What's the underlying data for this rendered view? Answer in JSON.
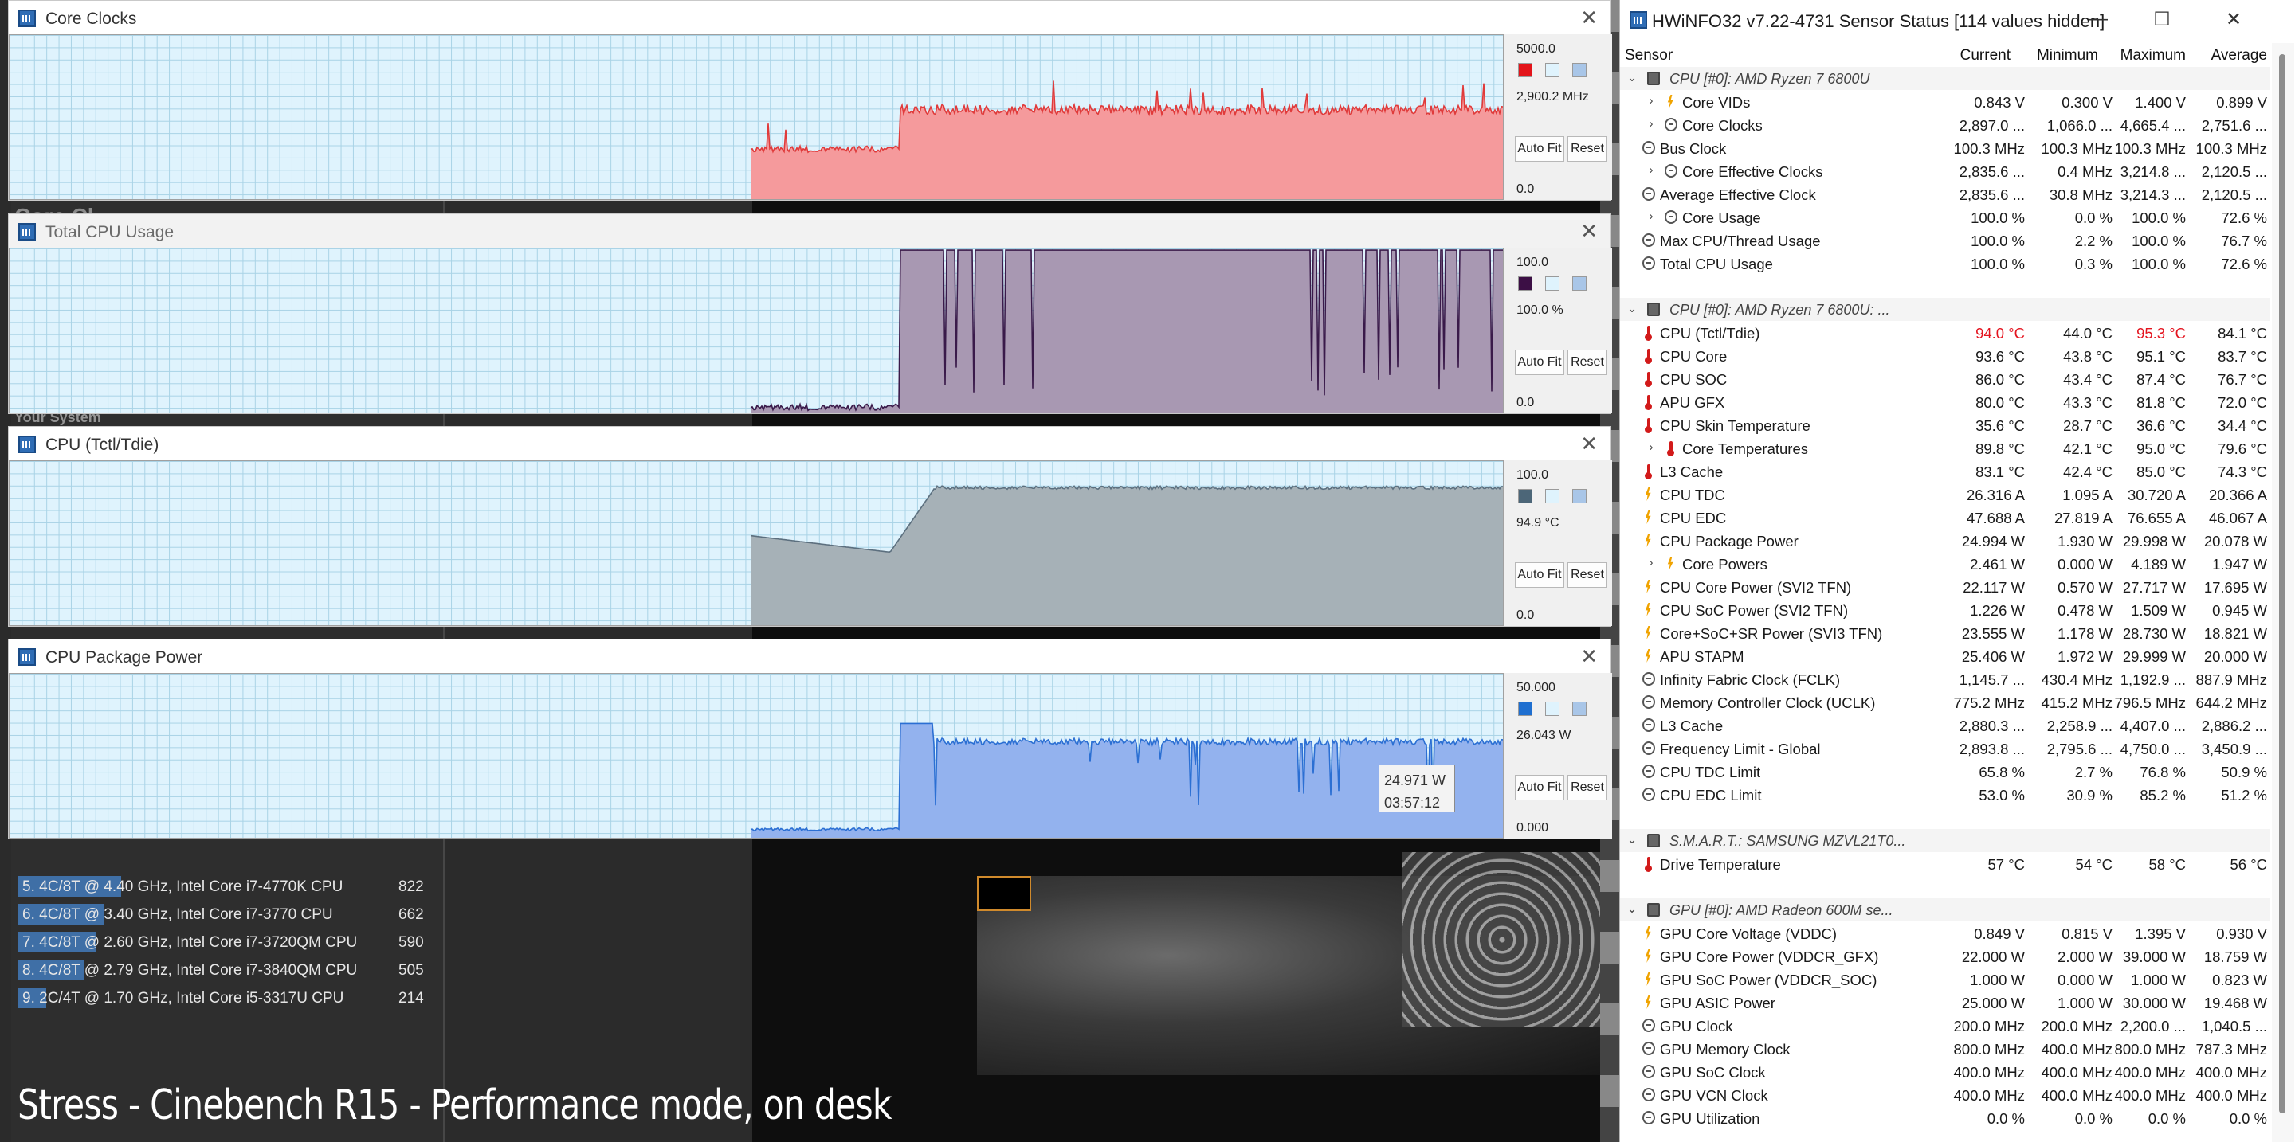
{
  "background": {
    "ghost_heading": "Core Cl...",
    "ghost_your_system": "Your System",
    "caption": "Stress - Cinebench R15 - Performance mode, on desk",
    "rankings": [
      {
        "label": "5. 4C/8T @ 4.40 GHz, Intel Core i7-4770K CPU",
        "score": "822",
        "bar_fraction": 0.25
      },
      {
        "label": "6. 4C/8T @ 3.40 GHz, Intel Core i7-3770 CPU",
        "score": "662",
        "bar_fraction": 0.21
      },
      {
        "label": "7. 4C/8T @ 2.60 GHz, Intel Core i7-3720QM CPU",
        "score": "590",
        "bar_fraction": 0.19
      },
      {
        "label": "8. 4C/8T @ 2.79 GHz, Intel Core i7-3840QM CPU",
        "score": "505",
        "bar_fraction": 0.16
      },
      {
        "label": "9. 2C/4T @ 1.70 GHz, Intel Core i5-3317U CPU",
        "score": "214",
        "bar_fraction": 0.07
      }
    ]
  },
  "graphs": [
    {
      "title": "Core Clocks",
      "max_label": "5000.0",
      "current_label": "2,900.2 MHz",
      "min_label": "0.0",
      "line_color": "#e03a3a",
      "fill_color": "#f59a9c",
      "swatch_color": "#e3141a",
      "active": true,
      "autofit_label": "Auto Fit",
      "reset_label": "Reset"
    },
    {
      "title": "Total CPU Usage",
      "max_label": "100.0",
      "current_label": "100.0 %",
      "min_label": "0.0",
      "line_color": "#3a1a4a",
      "fill_color": "#a898b2",
      "swatch_color": "#3c0f45",
      "active": false,
      "autofit_label": "Auto Fit",
      "reset_label": "Reset"
    },
    {
      "title": "CPU (Tctl/Tdie)",
      "max_label": "100.0",
      "current_label": "94.9 °C",
      "min_label": "0.0",
      "line_color": "#5c6f7e",
      "fill_color": "#a6b1b7",
      "swatch_color": "#4c6678",
      "active": true,
      "autofit_label": "Auto Fit",
      "reset_label": "Reset"
    },
    {
      "title": "CPU Package Power",
      "max_label": "50.000",
      "current_label": "26.043 W",
      "min_label": "0.000",
      "line_color": "#2b6fd3",
      "fill_color": "#93b2ee",
      "swatch_color": "#1f6fd0",
      "active": true,
      "autofit_label": "Auto Fit",
      "reset_label": "Reset"
    }
  ],
  "tooltip": {
    "value": "24.971 W",
    "time": "03:57:12"
  },
  "sensor_window": {
    "title": "HWiNFO32 v7.22-4731 Sensor Status [114 values hidden]",
    "headers": {
      "sensor": "Sensor",
      "current": "Current",
      "minimum": "Minimum",
      "maximum": "Maximum",
      "average": "Average"
    },
    "rows": [
      {
        "type": "group",
        "name": "CPU [#0]: AMD Ryzen 7 6800U"
      },
      {
        "name": "Core VIDs",
        "icon": "bolt",
        "expand": true,
        "cur": "0.843 V",
        "min": "0.300 V",
        "max": "1.400 V",
        "avg": "0.899 V"
      },
      {
        "name": "Core Clocks",
        "icon": "clock",
        "expand": true,
        "cur": "2,897.0 ...",
        "min": "1,066.0 ...",
        "max": "4,665.4 ...",
        "avg": "2,751.6 ..."
      },
      {
        "name": "Bus Clock",
        "icon": "clock",
        "cur": "100.3 MHz",
        "min": "100.3 MHz",
        "max": "100.3 MHz",
        "avg": "100.3 MHz"
      },
      {
        "name": "Core Effective Clocks",
        "icon": "clock",
        "expand": true,
        "cur": "2,835.6 ...",
        "min": "0.4 MHz",
        "max": "3,214.8 ...",
        "avg": "2,120.5 ..."
      },
      {
        "name": "Average Effective Clock",
        "icon": "clock",
        "cur": "2,835.6 ...",
        "min": "30.8 MHz",
        "max": "3,214.3 ...",
        "avg": "2,120.5 ..."
      },
      {
        "name": "Core Usage",
        "icon": "clock",
        "expand": true,
        "cur": "100.0 %",
        "min": "0.0 %",
        "max": "100.0 %",
        "avg": "72.6 %"
      },
      {
        "name": "Max CPU/Thread Usage",
        "icon": "clock",
        "cur": "100.0 %",
        "min": "2.2 %",
        "max": "100.0 %",
        "avg": "76.7 %"
      },
      {
        "name": "Total CPU Usage",
        "icon": "clock",
        "cur": "100.0 %",
        "min": "0.3 %",
        "max": "100.0 %",
        "avg": "72.6 %"
      },
      {
        "type": "blank"
      },
      {
        "type": "group",
        "name": "CPU [#0]: AMD Ryzen 7 6800U: ..."
      },
      {
        "name": "CPU (Tctl/Tdie)",
        "icon": "therm",
        "cur": "94.0 °C",
        "min": "44.0 °C",
        "max": "95.3 °C",
        "avg": "84.1 °C",
        "red_cur": true,
        "red_max": true
      },
      {
        "name": "CPU Core",
        "icon": "therm",
        "cur": "93.6 °C",
        "min": "43.8 °C",
        "max": "95.1 °C",
        "avg": "83.7 °C"
      },
      {
        "name": "CPU SOC",
        "icon": "therm",
        "cur": "86.0 °C",
        "min": "43.4 °C",
        "max": "87.4 °C",
        "avg": "76.7 °C"
      },
      {
        "name": "APU GFX",
        "icon": "therm",
        "cur": "80.0 °C",
        "min": "43.3 °C",
        "max": "81.8 °C",
        "avg": "72.0 °C"
      },
      {
        "name": "CPU Skin Temperature",
        "icon": "therm",
        "cur": "35.6 °C",
        "min": "28.7 °C",
        "max": "36.6 °C",
        "avg": "34.4 °C"
      },
      {
        "name": "Core Temperatures",
        "icon": "therm",
        "expand": true,
        "cur": "89.8 °C",
        "min": "42.1 °C",
        "max": "95.0 °C",
        "avg": "79.6 °C"
      },
      {
        "name": "L3 Cache",
        "icon": "therm",
        "cur": "83.1 °C",
        "min": "42.4 °C",
        "max": "85.0 °C",
        "avg": "74.3 °C"
      },
      {
        "name": "CPU TDC",
        "icon": "bolt",
        "cur": "26.316 A",
        "min": "1.095 A",
        "max": "30.720 A",
        "avg": "20.366 A"
      },
      {
        "name": "CPU EDC",
        "icon": "bolt",
        "cur": "47.688 A",
        "min": "27.819 A",
        "max": "76.655 A",
        "avg": "46.067 A"
      },
      {
        "name": "CPU Package Power",
        "icon": "bolt",
        "cur": "24.994 W",
        "min": "1.930 W",
        "max": "29.998 W",
        "avg": "20.078 W"
      },
      {
        "name": "Core Powers",
        "icon": "bolt",
        "expand": true,
        "cur": "2.461 W",
        "min": "0.000 W",
        "max": "4.189 W",
        "avg": "1.947 W"
      },
      {
        "name": "CPU Core Power (SVI2 TFN)",
        "icon": "bolt",
        "cur": "22.117 W",
        "min": "0.570 W",
        "max": "27.717 W",
        "avg": "17.695 W"
      },
      {
        "name": "CPU SoC Power (SVI2 TFN)",
        "icon": "bolt",
        "cur": "1.226 W",
        "min": "0.478 W",
        "max": "1.509 W",
        "avg": "0.945 W"
      },
      {
        "name": "Core+SoC+SR Power (SVI3 TFN)",
        "icon": "bolt",
        "cur": "23.555 W",
        "min": "1.178 W",
        "max": "28.730 W",
        "avg": "18.821 W"
      },
      {
        "name": "APU STAPM",
        "icon": "bolt",
        "cur": "25.406 W",
        "min": "1.972 W",
        "max": "29.999 W",
        "avg": "20.000 W"
      },
      {
        "name": "Infinity Fabric Clock (FCLK)",
        "icon": "clock",
        "cur": "1,145.7 ...",
        "min": "430.4 MHz",
        "max": "1,192.9 ...",
        "avg": "887.9 MHz"
      },
      {
        "name": "Memory Controller Clock (UCLK)",
        "icon": "clock",
        "cur": "775.2 MHz",
        "min": "415.2 MHz",
        "max": "796.5 MHz",
        "avg": "644.2 MHz"
      },
      {
        "name": "L3 Cache",
        "icon": "clock",
        "cur": "2,880.3 ...",
        "min": "2,258.9 ...",
        "max": "4,407.0 ...",
        "avg": "2,886.2 ..."
      },
      {
        "name": "Frequency Limit - Global",
        "icon": "clock",
        "cur": "2,893.8 ...",
        "min": "2,795.6 ...",
        "max": "4,750.0 ...",
        "avg": "3,450.9 ..."
      },
      {
        "name": "CPU TDC Limit",
        "icon": "clock",
        "cur": "65.8 %",
        "min": "2.7 %",
        "max": "76.8 %",
        "avg": "50.9 %"
      },
      {
        "name": "CPU EDC Limit",
        "icon": "clock",
        "cur": "53.0 %",
        "min": "30.9 %",
        "max": "85.2 %",
        "avg": "51.2 %"
      },
      {
        "type": "blank"
      },
      {
        "type": "group",
        "name": "S.M.A.R.T.: SAMSUNG MZVL21T0..."
      },
      {
        "name": "Drive Temperature",
        "icon": "therm",
        "cur": "57 °C",
        "min": "54 °C",
        "max": "58 °C",
        "avg": "56 °C"
      },
      {
        "type": "blank"
      },
      {
        "type": "group",
        "name": "GPU [#0]: AMD Radeon 600M se..."
      },
      {
        "name": "GPU Core Voltage (VDDC)",
        "icon": "bolt",
        "cur": "0.849 V",
        "min": "0.815 V",
        "max": "1.395 V",
        "avg": "0.930 V"
      },
      {
        "name": "GPU Core Power (VDDCR_GFX)",
        "icon": "bolt",
        "cur": "22.000 W",
        "min": "2.000 W",
        "max": "39.000 W",
        "avg": "18.759 W"
      },
      {
        "name": "GPU SoC Power (VDDCR_SOC)",
        "icon": "bolt",
        "cur": "1.000 W",
        "min": "0.000 W",
        "max": "1.000 W",
        "avg": "0.823 W"
      },
      {
        "name": "GPU ASIC Power",
        "icon": "bolt",
        "cur": "25.000 W",
        "min": "1.000 W",
        "max": "30.000 W",
        "avg": "19.468 W"
      },
      {
        "name": "GPU Clock",
        "icon": "clock",
        "cur": "200.0 MHz",
        "min": "200.0 MHz",
        "max": "2,200.0 ...",
        "avg": "1,040.5 ..."
      },
      {
        "name": "GPU Memory Clock",
        "icon": "clock",
        "cur": "800.0 MHz",
        "min": "400.0 MHz",
        "max": "800.0 MHz",
        "avg": "787.3 MHz"
      },
      {
        "name": "GPU SoC Clock",
        "icon": "clock",
        "cur": "400.0 MHz",
        "min": "400.0 MHz",
        "max": "400.0 MHz",
        "avg": "400.0 MHz"
      },
      {
        "name": "GPU VCN Clock",
        "icon": "clock",
        "cur": "400.0 MHz",
        "min": "400.0 MHz",
        "max": "400.0 MHz",
        "avg": "400.0 MHz"
      },
      {
        "name": "GPU Utilization",
        "icon": "clock",
        "cur": "0.0 %",
        "min": "0.0 %",
        "max": "0.0 %",
        "avg": "0.0 %"
      }
    ]
  }
}
